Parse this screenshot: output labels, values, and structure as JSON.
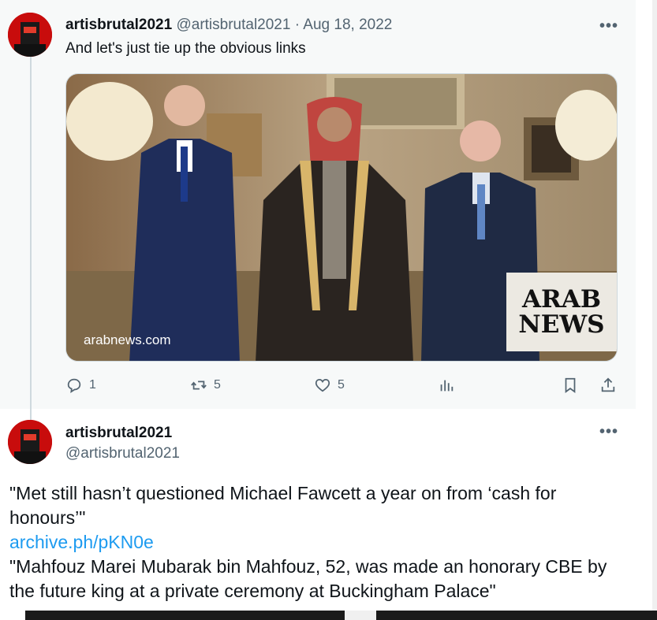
{
  "tweet1": {
    "display_name": "artisbrutal2021",
    "handle": "@artisbrutal2021",
    "separator": "·",
    "date": "Aug 18, 2022",
    "text": "And let's just tie up the obvious links",
    "media": {
      "caption": "arabnews.com",
      "brand_line1": "ARAB",
      "brand_line2": "NEWS"
    },
    "actions": {
      "replies": "1",
      "retweets": "5",
      "likes": "5"
    },
    "more_label": "•••"
  },
  "tweet2": {
    "display_name": "artisbrutal2021",
    "handle": "@artisbrutal2021",
    "more_label": "•••",
    "line1": "\"Met still hasn’t questioned Michael Fawcett a year on from ‘cash for honours’\"",
    "link": "archive.ph/pKN0e",
    "line2": "\"Mahfouz Marei Mubarak bin Mahfouz, 52, was made an honorary CBE by the future king at a private ceremony at Buckingham Palace\""
  },
  "colors": {
    "link": "#1d9bf0",
    "muted": "#536471",
    "avatar_red": "#c80c0c"
  }
}
